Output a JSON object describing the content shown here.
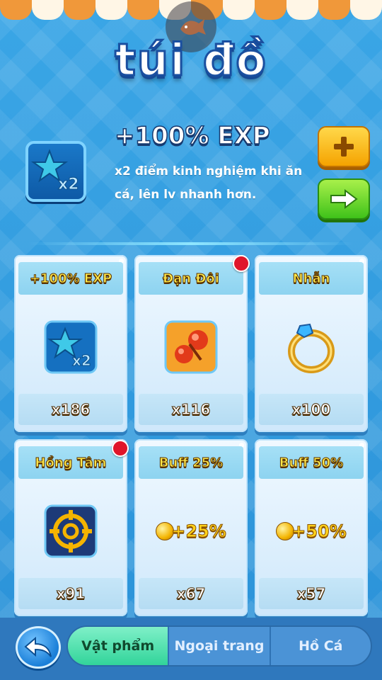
{
  "header": {
    "title": "túi đồ"
  },
  "featured": {
    "icon": "star-x2-icon",
    "title": "+100% EXP",
    "description": "x2 điểm kinh nghiệm khi ăn cá, lên lv nhanh hơn.",
    "plus_button_icon": "plus-icon",
    "next_button_icon": "arrow-right-icon"
  },
  "items": [
    {
      "name": "+100% EXP",
      "quantity": "x186",
      "icon": "star-x2-icon",
      "new": false
    },
    {
      "name": "Đạn Đôi",
      "quantity": "x116",
      "icon": "double-bullet-icon",
      "new": true
    },
    {
      "name": "Nhẫn",
      "quantity": "x100",
      "icon": "ring-icon",
      "new": false
    },
    {
      "name": "Hồng Tâm",
      "quantity": "x91",
      "icon": "crosshair-icon",
      "new": true
    },
    {
      "name": "Buff 25%",
      "quantity": "x67",
      "icon": "coin-icon",
      "buff_label": "+25%",
      "new": false
    },
    {
      "name": "Buff 50%",
      "quantity": "x57",
      "icon": "coin-icon",
      "buff_label": "+50%",
      "new": false
    }
  ],
  "tabs": [
    {
      "label": "Vật phẩm",
      "active": true
    },
    {
      "label": "Ngoại trang",
      "active": false
    },
    {
      "label": "Hồ Cá",
      "active": false
    }
  ],
  "colors": {
    "background": "#2b92d8",
    "active_tab": "#32d49a",
    "badge": "#e0152a"
  }
}
